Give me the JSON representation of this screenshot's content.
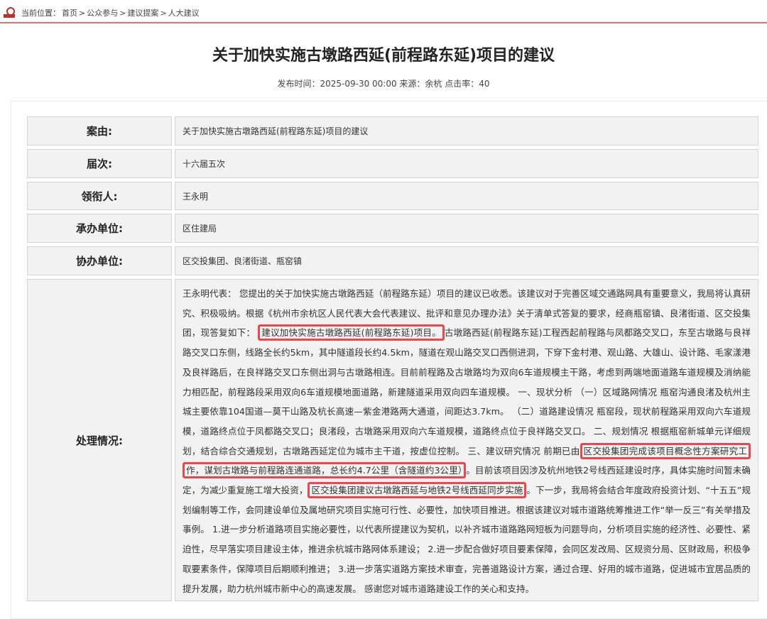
{
  "breadcrumb": {
    "prefix": "当前位置：",
    "items": [
      "首页",
      "公众参与",
      "建议提案",
      "人大建议"
    ],
    "sep": ">"
  },
  "article": {
    "title": "关于加快实施古墩路西延(前程路东延)项目的建议",
    "meta": "发布时间：2025-09-30 00:00 来源：余杭 点击率：40"
  },
  "rows": [
    {
      "label": "案由:",
      "value": "关于加快实施古墩路西延(前程路东延)项目的建议"
    },
    {
      "label": "届次:",
      "value": "十六届五次"
    },
    {
      "label": "领衔人:",
      "value": "王永明"
    },
    {
      "label": "承办单位:",
      "value": "区住建局"
    },
    {
      "label": "协办单位:",
      "value": "区交投集团、良渚街道、瓶窑镇"
    }
  ],
  "handling": {
    "label": "处理情况:",
    "segments": [
      "王永明代表： 您提出的关于加快实施古墩路西延（前程路东延）项目的建议已收悉。该建议对于完善区域交通路网具有重要意义，我局将认真研究、积极吸纳。根据《杭州市余杭区人民代表大会代表建议、批评和意见办理办法》关于清单式答复的要求，经商瓶窑镇、良渚街道、区交投集团，现答复如下： ",
      "建议加快实施古墩路西延(前程路东延)项目。",
      "古墩路西延(前程路东延)工程西起前程路与凤都路交叉口，东至古墩路与良祥路交叉口东侧，线路全长约5km，其中隧道段长约4.5km，隧道在观山路交叉口西侧进洞，下穿下金村港、观山路、大雄山、设计路、毛家漾港及良祥路后，在良祥路交叉口东侧出洞与古墩路相连。目前前程路及古墩路均为双向6车道规模主干路，考虑到两端地面道路车道规模及消纳能力相匹配，前程路段采用双向6车道规模地面道路，新建隧道采用双向四车道规模。 一、现状分析 （一）区域路网情况 瓶窑沟通良渚及杭州主城主要依靠104国道—莫干山路及杭长高速—紫金港路两大通道，间距达3.7km。 （二）道路建设情况 瓶窑段，现状前程路采用双向六车道规模，道路终点位于凤都路交叉口；良渚段，古墩路采用双向六车道规模，道路终点位于良祥路交叉口。 二、规划情况 根据瓶窑新城单元详细规划，结合综合交通规划，古墩路西延定位为城市主干道，按虚位控制。 三、建议研究情况 前期已由",
      "区交投集团完成该项目概念性方案研究工作，谋划古墩路与前程路连通道路，总长约4.7公里（含隧道约3公里）",
      "。目前该项目因涉及杭州地铁2号线西延建设时序，具体实施时间暂未确定，为减少重复施工增大投资，",
      "区交投集团建议古墩路西延与地铁2号线西延同步实施",
      "。下一步，我局将会结合年度政府投资计划、“十五五”规划编制等工作，会同建设单位及属地研究项目实施可行性、必要性，加快项目推进。根据该建议对城市道路统筹推进工作“举一反三”有关举措及事例。 1.进一步分析道路项目实施必要性，以代表所提建议为契机，以补齐城市道路路网短板为问题导向，分析项目实施的经济性、必要性、紧迫性，尽早落实项目建设主体，推进余杭城市路网体系建设； 2.进一步配合做好项目要素保障，会同区发改局、区规资分局、区财政局，积极争取要素条件，保障项目后期顺利推进； 3.进一步落实道路方案技术审查，完善道路设计方案，通过合理、好用的城市道路，促进城市宜居品质的提升发展，助力杭州城市新中心的高速发展。 感谢您对城市道路建设工作的关心和支持。"
    ]
  }
}
